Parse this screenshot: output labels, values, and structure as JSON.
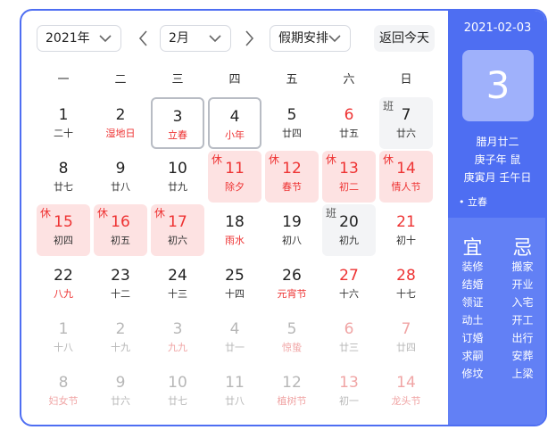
{
  "toolbar": {
    "year": "2021年",
    "month": "2月",
    "holiday_filter": "假期安排",
    "today_label": "返回今天"
  },
  "weekdays": [
    "一",
    "二",
    "三",
    "四",
    "五",
    "六",
    "日"
  ],
  "days": [
    {
      "n": "1",
      "l": "二十"
    },
    {
      "n": "2",
      "l": "湿地日",
      "lr": true
    },
    {
      "n": "3",
      "l": "立春",
      "lr": true,
      "selected": true
    },
    {
      "n": "4",
      "l": "小年",
      "lr": true,
      "selected": true
    },
    {
      "n": "5",
      "l": "廿四"
    },
    {
      "n": "6",
      "l": "廿五",
      "red": true
    },
    {
      "n": "7",
      "l": "廿六",
      "tag": "班",
      "work": true
    },
    {
      "n": "8",
      "l": "廿七"
    },
    {
      "n": "9",
      "l": "廿八"
    },
    {
      "n": "10",
      "l": "廿九"
    },
    {
      "n": "11",
      "l": "除夕",
      "lr": true,
      "red": true,
      "tag": "休",
      "holiday": true
    },
    {
      "n": "12",
      "l": "春节",
      "lr": true,
      "red": true,
      "tag": "休",
      "holiday": true
    },
    {
      "n": "13",
      "l": "初二",
      "lr": true,
      "red": true,
      "tag": "休",
      "holiday": true
    },
    {
      "n": "14",
      "l": "情人节",
      "lr": true,
      "red": true,
      "tag": "休",
      "holiday": true
    },
    {
      "n": "15",
      "l": "初四",
      "red": true,
      "tag": "休",
      "holiday": true
    },
    {
      "n": "16",
      "l": "初五",
      "red": true,
      "tag": "休",
      "holiday": true
    },
    {
      "n": "17",
      "l": "初六",
      "red": true,
      "tag": "休",
      "holiday": true
    },
    {
      "n": "18",
      "l": "雨水",
      "lr": true
    },
    {
      "n": "19",
      "l": "初八"
    },
    {
      "n": "20",
      "l": "初九",
      "tag": "班",
      "work": true
    },
    {
      "n": "21",
      "l": "初十",
      "red": true
    },
    {
      "n": "22",
      "l": "八九",
      "lr": true
    },
    {
      "n": "23",
      "l": "十二"
    },
    {
      "n": "24",
      "l": "十三"
    },
    {
      "n": "25",
      "l": "十四"
    },
    {
      "n": "26",
      "l": "元宵节",
      "lr": true
    },
    {
      "n": "27",
      "l": "十六",
      "red": true
    },
    {
      "n": "28",
      "l": "十七",
      "red": true
    },
    {
      "n": "1",
      "l": "十八",
      "faded": true
    },
    {
      "n": "2",
      "l": "十九",
      "faded": true
    },
    {
      "n": "3",
      "l": "九九",
      "lr": true,
      "faded": true
    },
    {
      "n": "4",
      "l": "廿一",
      "faded": true
    },
    {
      "n": "5",
      "l": "惊蛰",
      "lr": true,
      "faded": true
    },
    {
      "n": "6",
      "l": "廿三",
      "faded": true,
      "red": true
    },
    {
      "n": "7",
      "l": "廿四",
      "faded": true,
      "red": true
    },
    {
      "n": "8",
      "l": "妇女节",
      "lr": true,
      "faded": true
    },
    {
      "n": "9",
      "l": "廿六",
      "faded": true
    },
    {
      "n": "10",
      "l": "廿七",
      "faded": true
    },
    {
      "n": "11",
      "l": "廿八",
      "faded": true
    },
    {
      "n": "12",
      "l": "植树节",
      "lr": true,
      "faded": true
    },
    {
      "n": "13",
      "l": "初一",
      "faded": true,
      "red": true
    },
    {
      "n": "14",
      "l": "龙头节",
      "lr": true,
      "faded": true,
      "red": true
    }
  ],
  "side": {
    "date": "2021-02-03",
    "day": "3",
    "lunar": "腊月廿二",
    "year_zodiac": "庚子年 鼠",
    "month_day": "庚寅月 壬午日",
    "solar_term": "• 立春",
    "yi_label": "宜",
    "ji_label": "忌",
    "yi": [
      "装修",
      "结婚",
      "领证",
      "动土",
      "订婚",
      "求嗣",
      "修坟"
    ],
    "ji": [
      "搬家",
      "开业",
      "入宅",
      "开工",
      "出行",
      "安葬",
      "上梁"
    ]
  },
  "colors": {
    "accent": "#4e6ef2",
    "holiday_bg": "#fde2e2",
    "red": "#e33333"
  }
}
